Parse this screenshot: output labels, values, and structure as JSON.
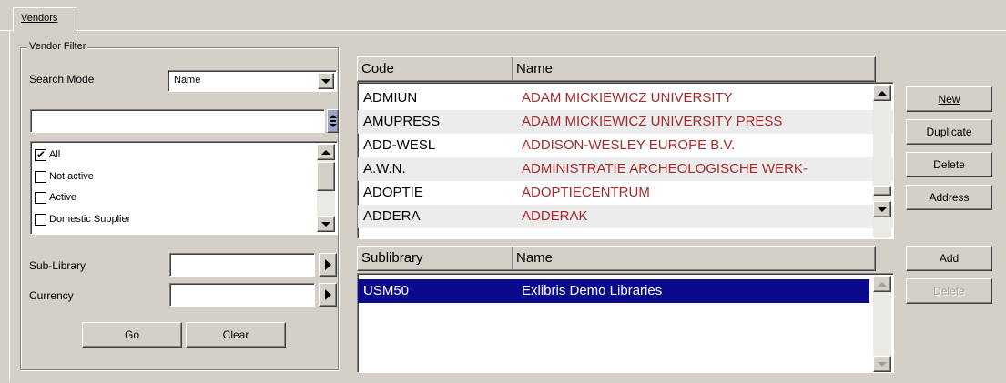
{
  "tabs": [
    {
      "label": "Vendors"
    }
  ],
  "vendor_filter": {
    "title": "Vendor Filter",
    "search_mode_label": "Search Mode",
    "search_mode_value": "Name",
    "search_input_value": "",
    "status_options": [
      {
        "label": "All",
        "checked": true
      },
      {
        "label": "Not active",
        "checked": false
      },
      {
        "label": "Active",
        "checked": false
      },
      {
        "label": "Domestic Supplier",
        "checked": false
      }
    ],
    "sub_library_label": "Sub-Library",
    "sub_library_value": "",
    "currency_label": "Currency",
    "currency_value": "",
    "go_label": "Go",
    "clear_label": "Clear"
  },
  "vendor_table": {
    "columns": [
      "Code",
      "Name"
    ],
    "rows": [
      {
        "code": "ADMIUN",
        "name": "ADAM MICKIEWICZ UNIVERSITY"
      },
      {
        "code": "AMUPRESS",
        "name": "ADAM MICKIEWICZ UNIVERSITY PRESS"
      },
      {
        "code": "ADD-WESL",
        "name": "ADDISON-WESLEY EUROPE B.V."
      },
      {
        "code": "A.W.N.",
        "name": "ADMINISTRATIE ARCHEOLOGISCHE WERK-"
      },
      {
        "code": "ADOPTIE",
        "name": "ADOPTIECENTRUM"
      },
      {
        "code": "ADDERA",
        "name": "ADDERAK"
      }
    ]
  },
  "vendor_buttons": {
    "new_label": "New",
    "duplicate_label": "Duplicate",
    "delete_label": "Delete",
    "address_label": "Address"
  },
  "sublibrary_table": {
    "columns": [
      "Sublibrary",
      "Name"
    ],
    "rows": [
      {
        "code": "USM50",
        "name": "Exlibris Demo Libraries",
        "selected": true
      }
    ]
  },
  "sublibrary_buttons": {
    "add_label": "Add",
    "delete_label": "Delete"
  },
  "colors": {
    "window_bg": "#d4d0c8",
    "selection": "#0a0a8c",
    "vendor_name_text": "#a52a2a"
  }
}
